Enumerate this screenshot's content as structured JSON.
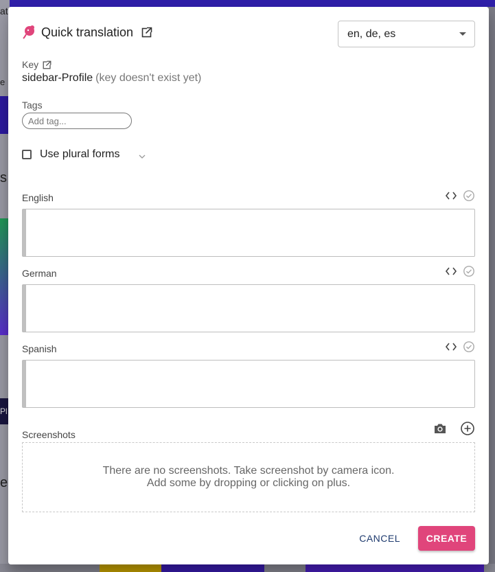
{
  "background": {
    "side_chars": [
      "at",
      "e",
      "s",
      "Pl",
      "e"
    ]
  },
  "dialog": {
    "title": "Quick translation",
    "title_icon": "external-link-icon",
    "logo_icon": "tolgee-mouse-logo",
    "languages_select": {
      "selected": "en, de, es"
    },
    "key": {
      "label": "Key",
      "value": "sidebar-Profile",
      "note": "(key doesn't exist yet)"
    },
    "tags": {
      "label": "Tags",
      "placeholder": "Add tag..."
    },
    "plural": {
      "label": "Use plural forms",
      "checked": false
    },
    "translations": [
      {
        "language": "English",
        "value": ""
      },
      {
        "language": "German",
        "value": ""
      },
      {
        "language": "Spanish",
        "value": ""
      }
    ],
    "screenshots": {
      "label": "Screenshots",
      "empty_line1": "There are no screenshots. Take screenshot by camera icon.",
      "empty_line2": "Add some by dropping or clicking on plus."
    },
    "actions": {
      "cancel": "CANCEL",
      "create": "CREATE"
    }
  },
  "colors": {
    "primary_pink": "#e0457b",
    "cancel_navy": "#1e3a6e",
    "state_bar_gray": "#c0c0c0"
  }
}
